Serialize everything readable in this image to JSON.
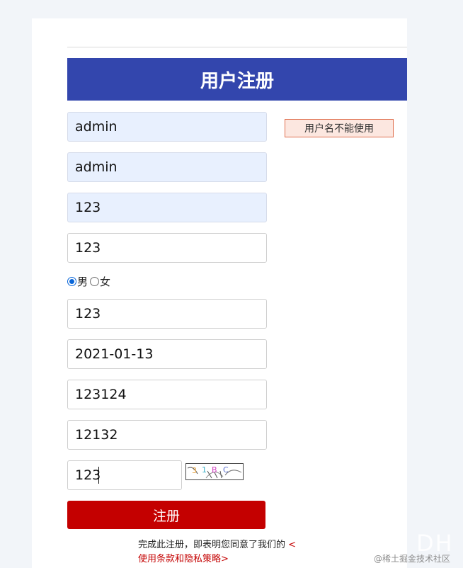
{
  "form": {
    "title": "用户注册",
    "username_value": "admin",
    "username_error": "用户名不能使用",
    "field2_value": "admin",
    "password_value": "123",
    "confirm_password_value": "123",
    "gender_options": [
      "男",
      "女"
    ],
    "gender_selected": "男",
    "field6_value": "123",
    "birthday_value": "2021-01-13",
    "field8_value": "123124",
    "field9_value": "12132",
    "captcha_value": "123",
    "captcha_image_text": "3 1 B C",
    "submit_label": "注册",
    "terms_text": "完成此注册，即表明您同意了我们的",
    "terms_link_open": "<",
    "terms_link_text": "使用条款和隐私策略",
    "terms_link_close": ">"
  },
  "watermark": {
    "logo_text": "DH",
    "site_text": "@稀土掘金技术社区"
  },
  "colors": {
    "title_bar": "#3346ad",
    "submit": "#c40000",
    "error_border": "#e0704f",
    "error_bg": "#fce7e0",
    "autofill_bg": "#e8f0fe"
  }
}
